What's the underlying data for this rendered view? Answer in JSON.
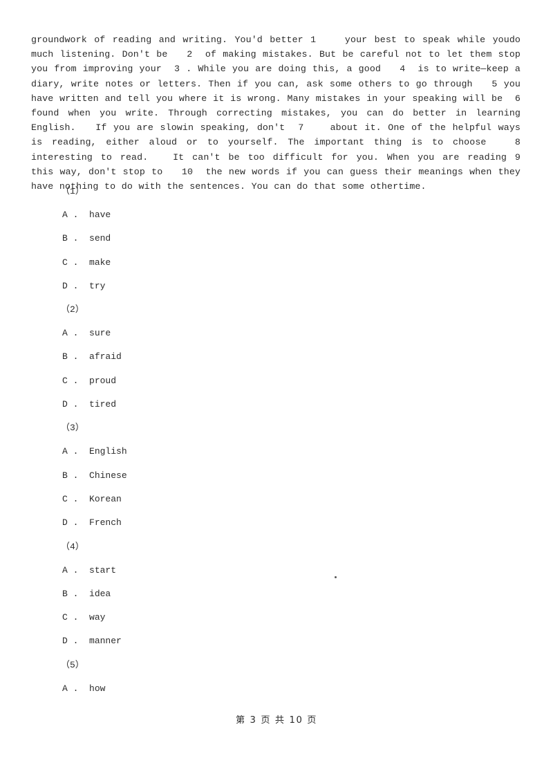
{
  "document": {
    "type": "exam-paper",
    "page_label": "第 3 页 共 10 页",
    "footer": {
      "prefix": "第",
      "current_page": "3",
      "middle": "页 共",
      "total_pages": "10",
      "suffix": "页",
      "full_text": "第 3 页 共 10 页"
    }
  },
  "passage": {
    "text": "groundwork of reading and writing. You'd better 1    your best to speak while youdo much listening. Don't be   2  of making mistakes. But be careful not to let them stop you from improving your  3 . While you are doing this, a good   4  is to write—keep a diary, write notes or letters. Then if you can, ask some others to go through   5 you have written and tell you where it is wrong. Many mistakes in your speaking will be  6    found when you write. Through correcting mistakes, you can do better in learning English.   If you are slowin speaking, don't  7    about it. One of the helpful ways is reading, either aloud or to yourself. The important thing is to choose   8  interesting to read.   It can't be too difficult for you. When you are reading 9    this way, don't stop to   10  the new words if you can guess their meanings when they have nothing to do with the sentences. You can do that some othertime."
  },
  "questions": [
    {
      "number": "（1）",
      "options": [
        {
          "letter": "A .",
          "text": "have"
        },
        {
          "letter": "B .",
          "text": "send"
        },
        {
          "letter": "C .",
          "text": "make"
        },
        {
          "letter": "D .",
          "text": "try"
        }
      ]
    },
    {
      "number": "（2）",
      "options": [
        {
          "letter": "A .",
          "text": "sure"
        },
        {
          "letter": "B .",
          "text": "afraid"
        },
        {
          "letter": "C .",
          "text": "proud"
        },
        {
          "letter": "D .",
          "text": "tired"
        }
      ]
    },
    {
      "number": "（3）",
      "options": [
        {
          "letter": "A .",
          "text": "English"
        },
        {
          "letter": "B .",
          "text": "Chinese"
        },
        {
          "letter": "C .",
          "text": "Korean"
        },
        {
          "letter": "D .",
          "text": "French"
        }
      ]
    },
    {
      "number": "（4）",
      "options": [
        {
          "letter": "A .",
          "text": "start"
        },
        {
          "letter": "B .",
          "text": "idea"
        },
        {
          "letter": "C .",
          "text": "way"
        },
        {
          "letter": "D .",
          "text": "manner"
        }
      ]
    },
    {
      "number": "（5）",
      "options": [
        {
          "letter": "A .",
          "text": "how"
        }
      ]
    }
  ],
  "colors": {
    "page_background": "#ffffff",
    "text": "#2b2b2b"
  }
}
